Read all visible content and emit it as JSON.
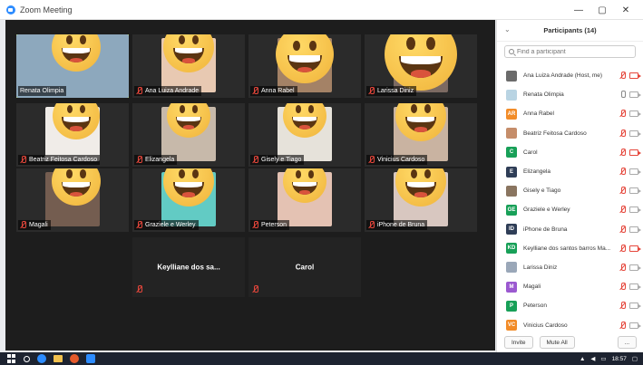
{
  "window": {
    "title": "Zoom Meeting",
    "min_label": "—",
    "max_label": "▢",
    "close_label": "✕"
  },
  "tiles": [
    {
      "name": "Renata Olimpia",
      "muted": false,
      "active": true
    },
    {
      "name": "Ana Luiza Andrade",
      "muted": true
    },
    {
      "name": "Anna Rabel",
      "muted": true
    },
    {
      "name": "Larissa Diniz",
      "muted": true
    },
    {
      "name": "Beatriz Feitosa Cardoso",
      "muted": true
    },
    {
      "name": "Elizangela",
      "muted": true
    },
    {
      "name": "Gisely e Tiago",
      "muted": true
    },
    {
      "name": "Vinicius Cardoso",
      "muted": true
    },
    {
      "name": "Magali",
      "muted": true
    },
    {
      "name": "Graziele e Werley",
      "muted": true
    },
    {
      "name": "Peterson",
      "muted": true
    },
    {
      "name": "iPhone de Bruna",
      "muted": true
    },
    {
      "name": "Keylliane dos sa...",
      "muted": true,
      "no_video": true
    },
    {
      "name": "Carol",
      "muted": true,
      "no_video": true
    }
  ],
  "panel": {
    "title": "Participants (14)",
    "search_placeholder": "Find a participant",
    "participants": [
      {
        "name": "Ana Luiza Andrade (Host, me)",
        "initials": "",
        "color": "#6b6b6b",
        "mic": "muted",
        "cam": "off"
      },
      {
        "name": "Renata Olimpia",
        "initials": "",
        "color": "#b9d4e3",
        "mic": "on",
        "cam": "on"
      },
      {
        "name": "Anna Rabel",
        "initials": "AR",
        "color": "#f28c28",
        "mic": "muted",
        "cam": "on"
      },
      {
        "name": "Beatriz Feitosa Cardoso",
        "initials": "",
        "color": "#c58d6a",
        "mic": "muted",
        "cam": "on"
      },
      {
        "name": "Carol",
        "initials": "C",
        "color": "#18a058",
        "mic": "muted",
        "cam": "off"
      },
      {
        "name": "Elizangela",
        "initials": "E",
        "color": "#2f3e57",
        "mic": "muted",
        "cam": "on"
      },
      {
        "name": "Gisely e Tiago",
        "initials": "",
        "color": "#8a7560",
        "mic": "muted",
        "cam": "on"
      },
      {
        "name": "Graziele e Werley",
        "initials": "GE",
        "color": "#18a058",
        "mic": "muted",
        "cam": "on"
      },
      {
        "name": "iPhone de Bruna",
        "initials": "ID",
        "color": "#2f3e57",
        "mic": "muted",
        "cam": "on"
      },
      {
        "name": "Keylliane dos santos barros Ma...",
        "initials": "KD",
        "color": "#18a058",
        "mic": "muted",
        "cam": "off"
      },
      {
        "name": "Larissa Diniz",
        "initials": "",
        "color": "#9aa7b8",
        "mic": "muted",
        "cam": "on"
      },
      {
        "name": "Magali",
        "initials": "M",
        "color": "#9b59d0",
        "mic": "muted",
        "cam": "on"
      },
      {
        "name": "Peterson",
        "initials": "P",
        "color": "#18a058",
        "mic": "muted",
        "cam": "on"
      },
      {
        "name": "Vinicius Cardoso",
        "initials": "VC",
        "color": "#f28c28",
        "mic": "muted",
        "cam": "on"
      }
    ],
    "invite_label": "Invite",
    "mute_all_label": "Mute All",
    "more_label": "..."
  },
  "taskbar": {
    "time": "18:57"
  }
}
